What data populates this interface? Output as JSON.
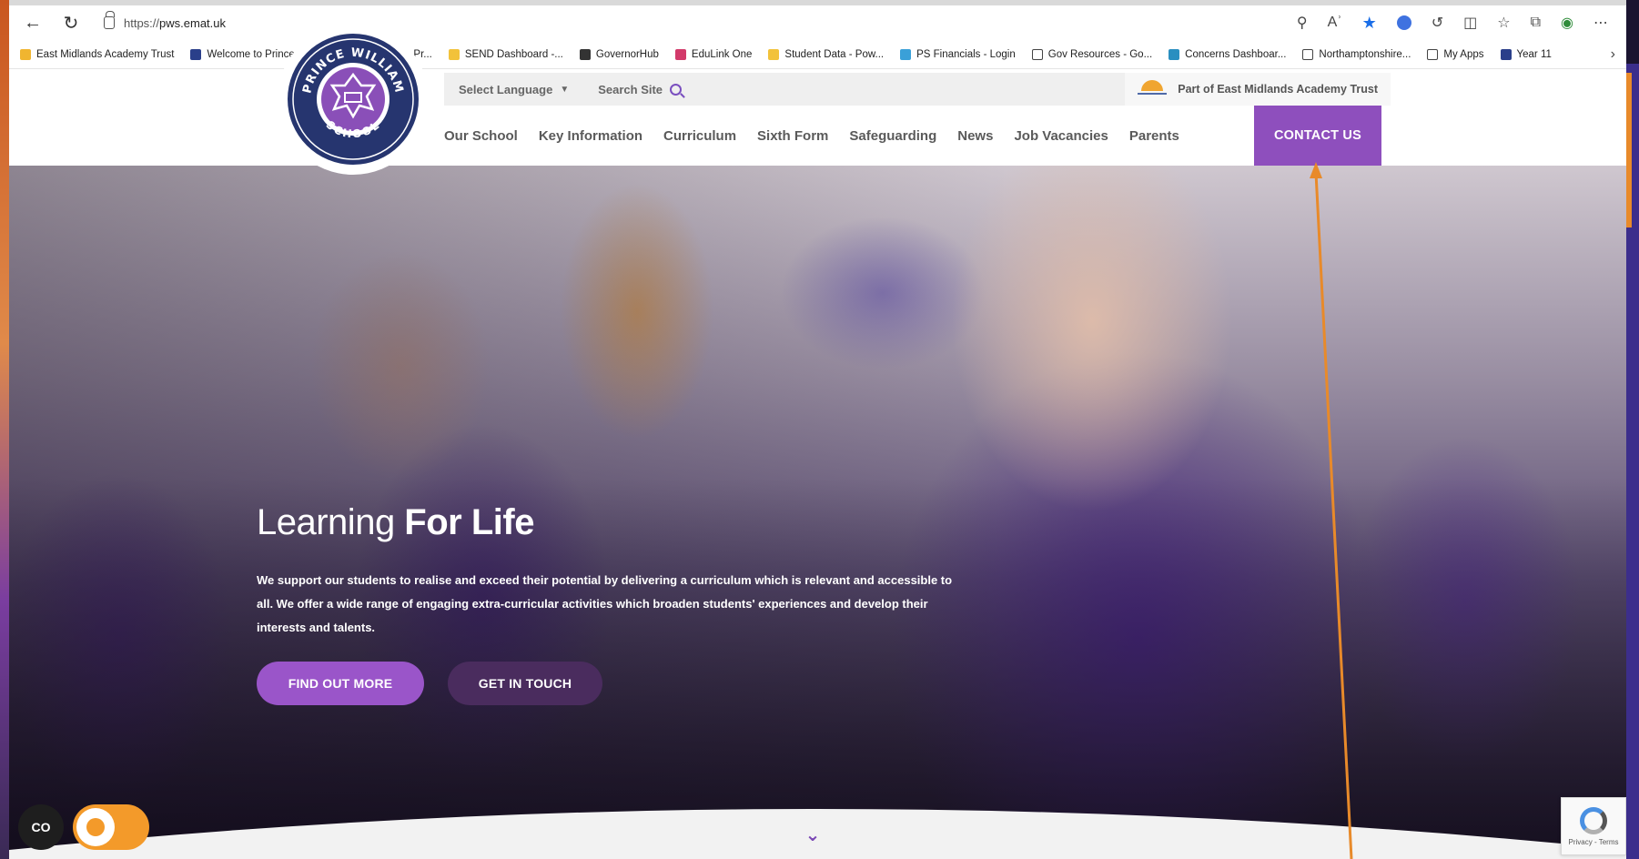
{
  "browser": {
    "url_prefix": "https://",
    "url_domain": "pws.emat.uk",
    "bookmarks": [
      {
        "label": "East Midlands Academy Trust",
        "icon": "folder-icon",
        "color": "#f0b530"
      },
      {
        "label": "Welcome to Prince...",
        "icon": "globe-icon",
        "color": "#2a3f8a"
      },
      {
        "label": "Learning Plan & Pr...",
        "icon": "person-icon",
        "color": "#2f8fd6"
      },
      {
        "label": "SEND Dashboard -...",
        "icon": "powerbi-icon",
        "color": "#f2c23a"
      },
      {
        "label": "GovernorHub",
        "icon": "governor-icon",
        "color": "#333333"
      },
      {
        "label": "EduLink One",
        "icon": "pin-icon",
        "color": "#d23a6a"
      },
      {
        "label": "Student Data - Pow...",
        "icon": "powerbi-icon",
        "color": "#f2c23a"
      },
      {
        "label": "PS Financials - Login",
        "icon": "circle-icon",
        "color": "#3aa0d8"
      },
      {
        "label": "Gov Resources - Go...",
        "icon": "page-icon",
        "color": "#ffffff"
      },
      {
        "label": "Concerns Dashboar...",
        "icon": "concern-icon",
        "color": "#2a8fc0"
      },
      {
        "label": "Northamptonshire...",
        "icon": "page-icon",
        "color": "#ffffff"
      },
      {
        "label": "My Apps",
        "icon": "page-icon",
        "color": "#ffffff"
      },
      {
        "label": "Year 11",
        "icon": "globe-icon",
        "color": "#2a3f8a"
      }
    ]
  },
  "site": {
    "logo": {
      "top_text": "PRINCE WILLIAM",
      "bottom_text": "SCHOOL"
    },
    "utility": {
      "language": "Select Language",
      "search": "Search Site",
      "trust": "Part of East Midlands Academy Trust"
    },
    "nav": [
      "Our School",
      "Key Information",
      "Curriculum",
      "Sixth Form",
      "Safeguarding",
      "News",
      "Job Vacancies",
      "Parents"
    ],
    "contact": "CONTACT US",
    "hero": {
      "title_light": "Learning ",
      "title_bold": "For Life",
      "text": "We support our students to realise and exceed their potential by delivering a curriculum which is relevant and accessible to all.  We offer a wide range of engaging extra-curricular activities which broaden students' experiences and develop their interests and talents.",
      "primary_button": "FIND OUT MORE",
      "secondary_button": "GET IN TOUCH"
    },
    "accessibility_label": "CO",
    "recaptcha": "Privacy - Terms"
  },
  "colors": {
    "brand_purple": "#8e4fbd",
    "annotation_orange": "#e88a2a"
  }
}
